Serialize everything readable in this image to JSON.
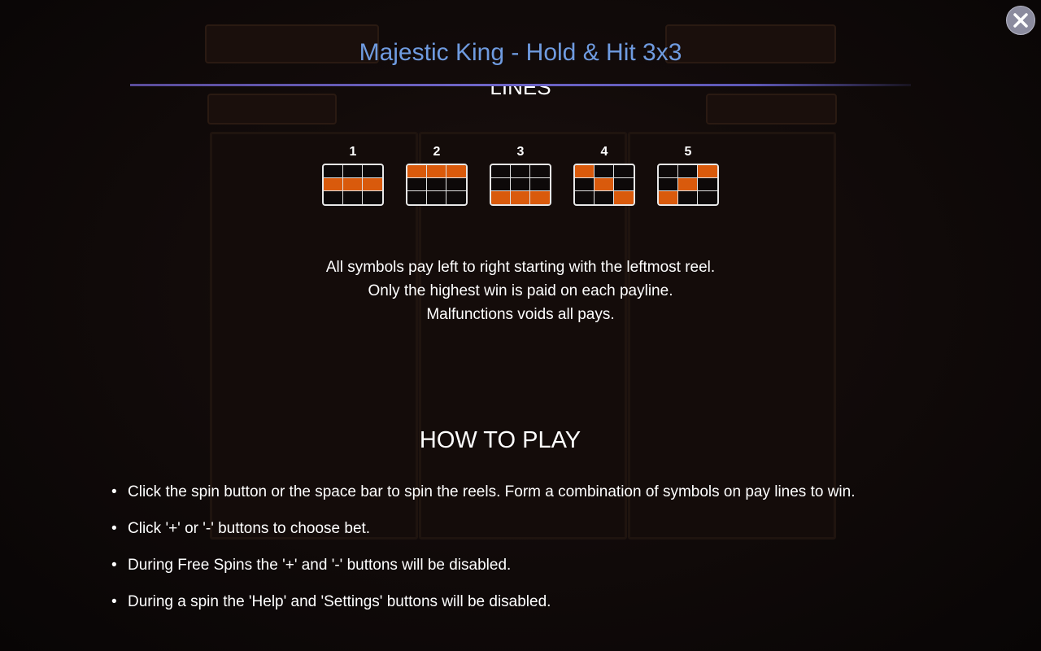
{
  "header": {
    "title": "Majestic King - Hold & Hit 3x3",
    "close_icon": "close-icon"
  },
  "lines_section": {
    "heading": "LINES",
    "lines": [
      {
        "label": "1",
        "pattern": [
          [
            0,
            0,
            0
          ],
          [
            1,
            1,
            1
          ],
          [
            0,
            0,
            0
          ]
        ]
      },
      {
        "label": "2",
        "pattern": [
          [
            1,
            1,
            1
          ],
          [
            0,
            0,
            0
          ],
          [
            0,
            0,
            0
          ]
        ]
      },
      {
        "label": "3",
        "pattern": [
          [
            0,
            0,
            0
          ],
          [
            0,
            0,
            0
          ],
          [
            1,
            1,
            1
          ]
        ]
      },
      {
        "label": "4",
        "pattern": [
          [
            1,
            0,
            0
          ],
          [
            0,
            1,
            0
          ],
          [
            0,
            0,
            1
          ]
        ]
      },
      {
        "label": "5",
        "pattern": [
          [
            0,
            0,
            1
          ],
          [
            0,
            1,
            0
          ],
          [
            1,
            0,
            0
          ]
        ]
      }
    ],
    "highlight_color": "#d95a0c",
    "rules": [
      "All symbols pay left to right starting with the leftmost reel.",
      "Only the highest win is paid on each payline.",
      "Malfunctions voids all pays."
    ]
  },
  "how_to_play": {
    "heading": "HOW TO PLAY",
    "items": [
      "Click the spin button or the space bar  to spin the reels. Form a combination of symbols on pay lines to win.",
      "Click '+' or '-' buttons to choose bet.",
      "During Free Spins the '+' and '-' buttons will be disabled.",
      "During a spin the 'Help' and 'Settings' buttons will be disabled."
    ]
  },
  "colors": {
    "title": "#6f9be0",
    "divider": "#6f66c8",
    "text": "#ffffff",
    "background": "#0b0707"
  }
}
